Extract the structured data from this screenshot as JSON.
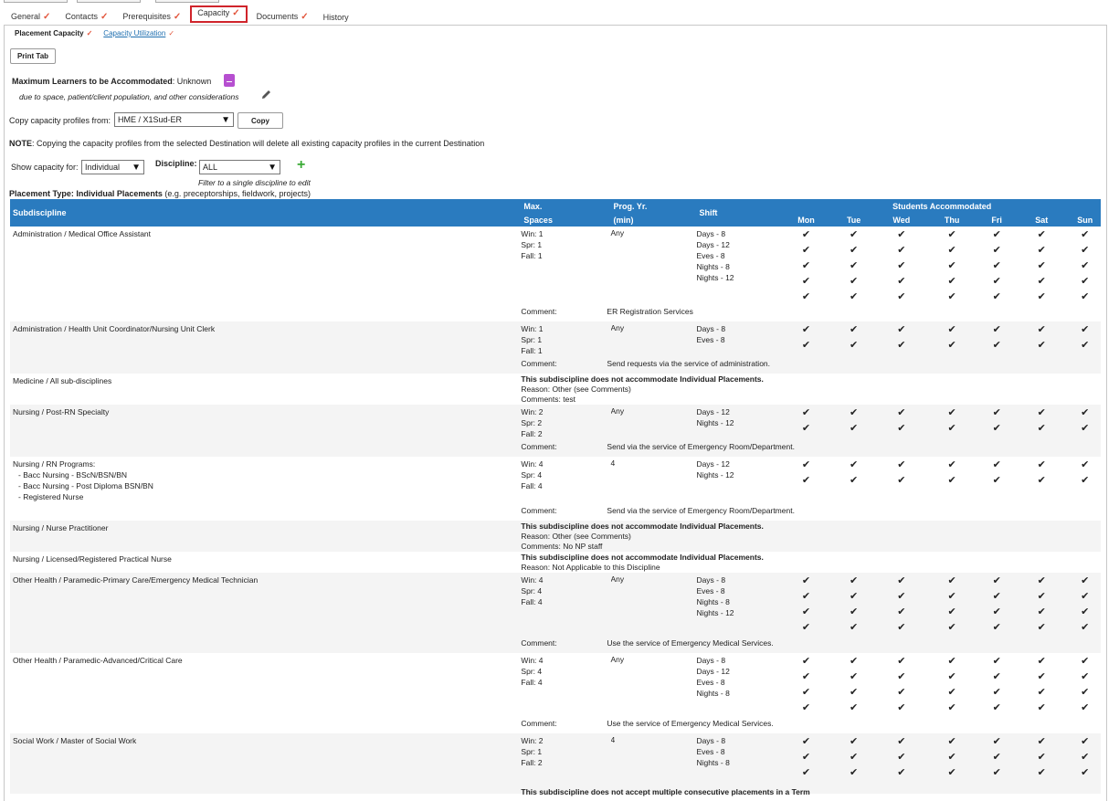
{
  "tabs": [
    {
      "label": "General",
      "checked": true
    },
    {
      "label": "Contacts",
      "checked": true
    },
    {
      "label": "Prerequisites",
      "checked": true
    },
    {
      "label": "Capacity",
      "checked": true,
      "active": true
    },
    {
      "label": "Documents",
      "checked": true
    },
    {
      "label": "History",
      "checked": false
    }
  ],
  "check_glyph": "✓",
  "tick_glyph": "✔",
  "subtabs": {
    "placement": "Placement Capacity",
    "utilization": "Capacity Utilization"
  },
  "print_button": "Print Tab",
  "max_learners": {
    "label": "Maximum Learners to be Accommodated",
    "value": "Unknown",
    "note": "due to space, patient/client population, and other considerations"
  },
  "copy": {
    "label": "Copy capacity profiles from:",
    "value": "HME / X1Sud-ER",
    "button": "Copy"
  },
  "note": {
    "label": "NOTE",
    "text": "Copying the capacity profiles from the selected Destination will delete all existing capacity profiles in the current Destination"
  },
  "filters": {
    "show_label": "Show capacity for:",
    "show_value": "Individual",
    "discipline_label": "Discipline:",
    "discipline_value": "ALL",
    "hint": "Filter to a single discipline to edit"
  },
  "placement_type": {
    "label": "Placement Type: Individual Placements",
    "sub": "(e.g. preceptorships, fieldwork, projects)"
  },
  "table": {
    "headers": {
      "subdiscipline": "Subdiscipline",
      "max": "Max.",
      "spaces": "Spaces",
      "prog": "Prog. Yr.",
      "min": "(min)",
      "shift": "Shift",
      "students": "Students Accommodated",
      "days": [
        "Mon",
        "Tue",
        "Wed",
        "Thu",
        "Fri",
        "Sat",
        "Sun"
      ]
    },
    "comment_label": "Comment:",
    "rows": [
      {
        "sub": [
          "Administration / Medical Office Assistant"
        ],
        "spaces": [
          "Win: 1",
          "Spr: 1",
          "Fall: 1"
        ],
        "prog": "Any",
        "shifts": [
          "Days - 8",
          "Days - 12",
          "Eves - 8",
          "Nights - 8",
          "Nights - 12"
        ],
        "comment": "ER Registration Services",
        "tickrows": 5,
        "height": 104
      },
      {
        "sub": [
          "Administration / Health Unit Coordinator/Nursing Unit Clerk"
        ],
        "spaces": [
          "Win: 1",
          "Spr: 1",
          "Fall: 1"
        ],
        "prog": "Any",
        "shifts": [
          "Days - 8",
          "Eves - 8"
        ],
        "comment": "Send requests via the service of administration.",
        "tickrows": 2,
        "height": 57,
        "alt": true
      },
      {
        "sub": [
          "Medicine / All sub-disciplines"
        ],
        "notice": [
          "This subdiscipline does not accommodate Individual Placements.",
          "Reason: Other (see Comments)",
          "Comments: test"
        ],
        "height": 34
      },
      {
        "sub": [
          "Nursing / Post-RN Specialty"
        ],
        "spaces": [
          "Win: 2",
          "Spr: 2",
          "Fall: 2"
        ],
        "prog": "Any",
        "shifts": [
          "Days - 12",
          "Nights - 12"
        ],
        "comment": "Send via the service of Emergency Room/Department.",
        "tickrows": 2,
        "height": 57,
        "alt": true
      },
      {
        "sub": [
          "Nursing / RN Programs:",
          "- Bacc Nursing - BScN/BSN/BN",
          "- Bacc Nursing - Post Diploma BSN/BN",
          "- Registered Nurse"
        ],
        "spaces": [
          "Win: 4",
          "Spr: 4",
          "Fall: 4"
        ],
        "prog": "4",
        "shifts": [
          "Days - 12",
          "Nights - 12"
        ],
        "comment": "Send via the service of Emergency Room/Department.",
        "tickrows": 2,
        "height": 70
      },
      {
        "sub": [
          "Nursing / Nurse Practitioner"
        ],
        "notice": [
          "This subdiscipline does not accommodate Individual Placements.",
          "Reason: Other (see Comments)",
          "Comments: No NP staff"
        ],
        "height": 33,
        "alt": true
      },
      {
        "sub": [
          "Nursing / Licensed/Registered Practical Nurse"
        ],
        "notice": [
          "This subdiscipline does not accommodate Individual Placements.",
          "Reason: Not Applicable to this Discipline"
        ],
        "height": 22
      },
      {
        "sub": [
          "Other Health / Paramedic-Primary Care/Emergency Medical Technician"
        ],
        "spaces": [
          "Win: 4",
          "Spr: 4",
          "Fall: 4"
        ],
        "prog": "Any",
        "shifts": [
          "Days - 8",
          "Eves - 8",
          "Nights - 8",
          "Nights - 12"
        ],
        "comment": "Use the service of Emergency Medical Services.",
        "tickrows": 4,
        "height": 88,
        "alt": true
      },
      {
        "sub": [
          "Other Health / Paramedic-Advanced/Critical Care"
        ],
        "spaces": [
          "Win: 4",
          "Spr: 4",
          "Fall: 4"
        ],
        "prog": "Any",
        "shifts": [
          "Days - 8",
          "Days - 12",
          "Eves - 8",
          "Nights - 8"
        ],
        "comment": "Use the service of Emergency Medical Services.",
        "tickrows": 4,
        "height": 88
      },
      {
        "sub": [
          "Social Work / Master of Social Work"
        ],
        "spaces": [
          "Win: 2",
          "Spr: 1",
          "Fall: 2"
        ],
        "prog": "4",
        "shifts": [
          "Days - 8",
          "Eves - 8",
          "Nights - 8"
        ],
        "footer": "This subdiscipline does not accept multiple consecutive placements in a Term",
        "tickrows": 3,
        "height": 66,
        "alt": true
      }
    ]
  }
}
